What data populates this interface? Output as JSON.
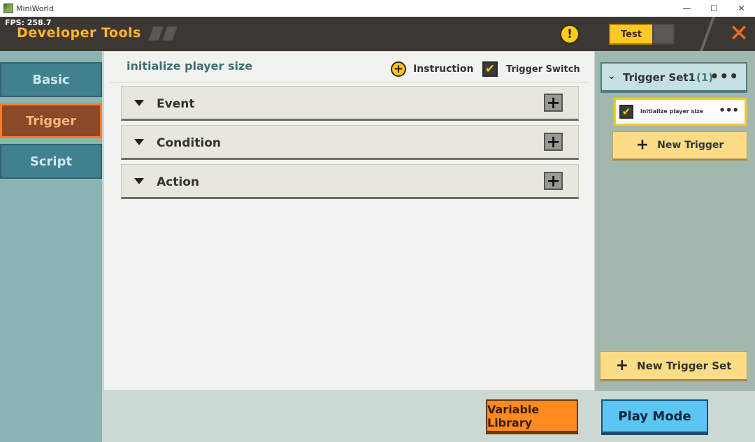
{
  "window": {
    "title": "MiniWorld",
    "minimize_icon": "—",
    "maximize_icon": "☐",
    "close_icon": "✕"
  },
  "header": {
    "fps": "FPS: 258.7",
    "title": "Developer Tools",
    "warning_icon": "!",
    "test_label": "Test",
    "close_icon": "✕",
    "accent_color": "#ffb42e"
  },
  "leftnav": {
    "items": [
      {
        "label": "Basic",
        "active": false
      },
      {
        "label": "Trigger",
        "active": true
      },
      {
        "label": "Script",
        "active": false
      }
    ]
  },
  "main": {
    "trigger_name": "initialize player size",
    "instruction_icon": "+",
    "instruction_label": "Instruction",
    "trigger_switch_checked": "✔",
    "trigger_switch_label": "Trigger Switch",
    "sections": [
      {
        "label": "Event",
        "add": "+"
      },
      {
        "label": "Condition",
        "add": "+"
      },
      {
        "label": "Action",
        "add": "+"
      }
    ]
  },
  "rightpanel": {
    "set_chevron": "⌄",
    "set_name": "Trigger Set1",
    "set_count": "(1)",
    "set_more": "•••",
    "trigger_item": {
      "checked": "✔",
      "label": "initialize player size",
      "more": "•••"
    },
    "new_trigger_icon": "+",
    "new_trigger_label": "New Trigger",
    "new_set_icon": "+",
    "new_set_label": "New Trigger Set"
  },
  "bottom": {
    "variable_library_label": "Variable Library",
    "play_mode_label": "Play Mode"
  }
}
